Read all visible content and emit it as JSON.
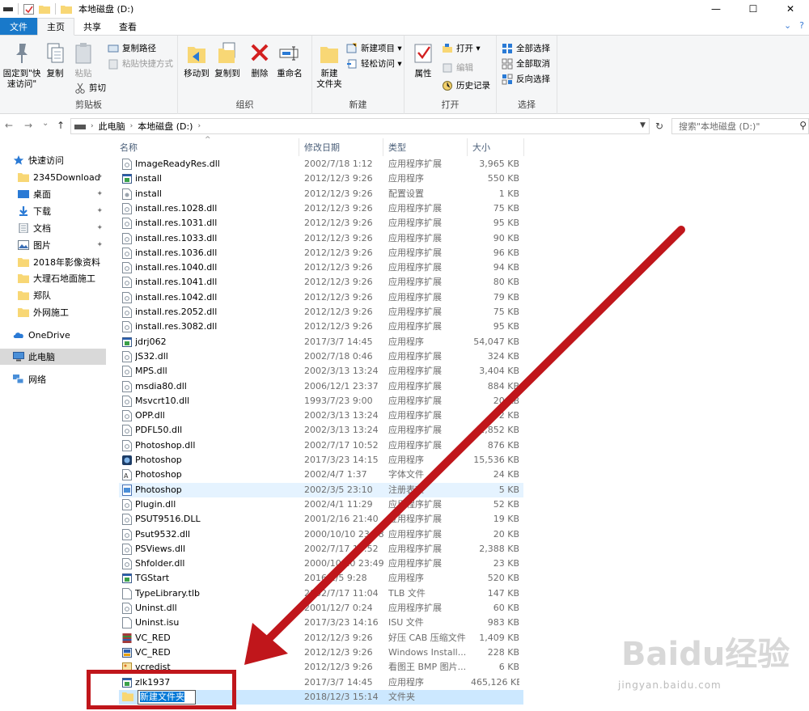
{
  "window": {
    "title": "本地磁盘 (D:)",
    "minimize": "—",
    "maximize": "☐",
    "close": "✕"
  },
  "tabs": {
    "file": "文件",
    "home": "主页",
    "share": "共享",
    "view": "查看"
  },
  "ribbon": {
    "clipboard": {
      "label": "剪贴板",
      "pin": "固定到\"快速访问\"",
      "copy": "复制",
      "paste": "粘贴",
      "copy_path": "复制路径",
      "paste_shortcut": "粘贴快捷方式",
      "cut": "剪切"
    },
    "organize": {
      "label": "组织",
      "move_to": "移动到",
      "copy_to": "复制到",
      "delete": "删除",
      "rename": "重命名"
    },
    "new": {
      "label": "新建",
      "new_folder": "新建\n文件夹",
      "new_item": "新建项目 ▾",
      "easy_access": "轻松访问 ▾"
    },
    "open": {
      "label": "打开",
      "properties": "属性",
      "open": "打开 ▾",
      "edit": "编辑",
      "history": "历史记录"
    },
    "select": {
      "label": "选择",
      "select_all": "全部选择",
      "select_none": "全部取消",
      "invert": "反向选择"
    }
  },
  "address": {
    "back": "←",
    "forward": "→",
    "recent": "⌄",
    "up": "↑",
    "crumb1": "此电脑",
    "crumb2": "本地磁盘 (D:)",
    "search_placeholder": "搜索\"本地磁盘 (D:)\""
  },
  "nav": [
    {
      "label": "快速访问",
      "icon": "star-icon",
      "pinned": false
    },
    {
      "label": "2345Download",
      "icon": "folder-icon",
      "pinned": true
    },
    {
      "label": "桌面",
      "icon": "desktop-icon",
      "pinned": true
    },
    {
      "label": "下载",
      "icon": "download-icon",
      "pinned": true
    },
    {
      "label": "文档",
      "icon": "document-icon",
      "pinned": true
    },
    {
      "label": "图片",
      "icon": "picture-icon",
      "pinned": true
    },
    {
      "label": "2018年影像资料",
      "icon": "folder-icon",
      "pinned": false
    },
    {
      "label": "大理石地面施工",
      "icon": "folder-icon",
      "pinned": false
    },
    {
      "label": "郑队",
      "icon": "folder-icon",
      "pinned": false
    },
    {
      "label": "外网施工",
      "icon": "folder-icon",
      "pinned": false
    },
    {
      "label": "OneDrive",
      "icon": "cloud-icon",
      "pinned": false
    },
    {
      "label": "此电脑",
      "icon": "computer-icon",
      "pinned": false
    },
    {
      "label": "网络",
      "icon": "network-icon",
      "pinned": false
    }
  ],
  "columns": {
    "name": "名称",
    "date": "修改日期",
    "type": "类型",
    "size": "大小"
  },
  "files": [
    {
      "name": "ImageReadyRes.dll",
      "date": "2002/7/18 1:12",
      "type": "应用程序扩展",
      "size": "3,965 KB",
      "icon": "dll-icon"
    },
    {
      "name": "install",
      "date": "2012/12/3 9:26",
      "type": "应用程序",
      "size": "550 KB",
      "icon": "exe-icon"
    },
    {
      "name": "install",
      "date": "2012/12/3 9:26",
      "type": "配置设置",
      "size": "1 KB",
      "icon": "ini-icon"
    },
    {
      "name": "install.res.1028.dll",
      "date": "2012/12/3 9:26",
      "type": "应用程序扩展",
      "size": "75 KB",
      "icon": "dll-icon"
    },
    {
      "name": "install.res.1031.dll",
      "date": "2012/12/3 9:26",
      "type": "应用程序扩展",
      "size": "95 KB",
      "icon": "dll-icon"
    },
    {
      "name": "install.res.1033.dll",
      "date": "2012/12/3 9:26",
      "type": "应用程序扩展",
      "size": "90 KB",
      "icon": "dll-icon"
    },
    {
      "name": "install.res.1036.dll",
      "date": "2012/12/3 9:26",
      "type": "应用程序扩展",
      "size": "96 KB",
      "icon": "dll-icon"
    },
    {
      "name": "install.res.1040.dll",
      "date": "2012/12/3 9:26",
      "type": "应用程序扩展",
      "size": "94 KB",
      "icon": "dll-icon"
    },
    {
      "name": "install.res.1041.dll",
      "date": "2012/12/3 9:26",
      "type": "应用程序扩展",
      "size": "80 KB",
      "icon": "dll-icon"
    },
    {
      "name": "install.res.1042.dll",
      "date": "2012/12/3 9:26",
      "type": "应用程序扩展",
      "size": "79 KB",
      "icon": "dll-icon"
    },
    {
      "name": "install.res.2052.dll",
      "date": "2012/12/3 9:26",
      "type": "应用程序扩展",
      "size": "75 KB",
      "icon": "dll-icon"
    },
    {
      "name": "install.res.3082.dll",
      "date": "2012/12/3 9:26",
      "type": "应用程序扩展",
      "size": "95 KB",
      "icon": "dll-icon"
    },
    {
      "name": "jdrj062",
      "date": "2017/3/7 14:45",
      "type": "应用程序",
      "size": "54,047 KB",
      "icon": "exe-icon"
    },
    {
      "name": "JS32.dll",
      "date": "2002/7/18 0:46",
      "type": "应用程序扩展",
      "size": "324 KB",
      "icon": "dll-icon"
    },
    {
      "name": "MPS.dll",
      "date": "2002/3/13 13:24",
      "type": "应用程序扩展",
      "size": "3,404 KB",
      "icon": "dll-icon"
    },
    {
      "name": "msdia80.dll",
      "date": "2006/12/1 23:37",
      "type": "应用程序扩展",
      "size": "884 KB",
      "icon": "dll-icon"
    },
    {
      "name": "Msvcrt10.dll",
      "date": "1993/7/23 9:00",
      "type": "应用程序扩展",
      "size": "20 KB",
      "icon": "dll-icon"
    },
    {
      "name": "OPP.dll",
      "date": "2002/3/13 13:24",
      "type": "应用程序扩展",
      "size": "92 KB",
      "icon": "dll-icon"
    },
    {
      "name": "PDFL50.dll",
      "date": "2002/3/13 13:24",
      "type": "应用程序扩展",
      "size": "2,852 KB",
      "icon": "dll-icon"
    },
    {
      "name": "Photoshop.dll",
      "date": "2002/7/17 10:52",
      "type": "应用程序扩展",
      "size": "876 KB",
      "icon": "dll-icon"
    },
    {
      "name": "Photoshop",
      "date": "2017/3/23 14:15",
      "type": "应用程序",
      "size": "15,536 KB",
      "icon": "photoshop-icon"
    },
    {
      "name": "Photoshop",
      "date": "2002/4/7 1:37",
      "type": "字体文件",
      "size": "24 KB",
      "icon": "font-icon"
    },
    {
      "name": "Photoshop",
      "date": "2002/3/5 23:10",
      "type": "注册表项",
      "size": "5 KB",
      "icon": "registry-icon"
    },
    {
      "name": "Plugin.dll",
      "date": "2002/4/1 11:29",
      "type": "应用程序扩展",
      "size": "52 KB",
      "icon": "dll-icon"
    },
    {
      "name": "PSUT9516.DLL",
      "date": "2001/2/16 21:40",
      "type": "应用程序扩展",
      "size": "19 KB",
      "icon": "dll-icon"
    },
    {
      "name": "Psut9532.dll",
      "date": "2000/10/10 23:48",
      "type": "应用程序扩展",
      "size": "20 KB",
      "icon": "dll-icon"
    },
    {
      "name": "PSViews.dll",
      "date": "2002/7/17 10:52",
      "type": "应用程序扩展",
      "size": "2,388 KB",
      "icon": "dll-icon"
    },
    {
      "name": "Shfolder.dll",
      "date": "2000/10/10 23:49",
      "type": "应用程序扩展",
      "size": "23 KB",
      "icon": "dll-icon"
    },
    {
      "name": "TGStart",
      "date": "2016/1/5 9:28",
      "type": "应用程序",
      "size": "520 KB",
      "icon": "exe-icon"
    },
    {
      "name": "TypeLibrary.tlb",
      "date": "2002/7/17 11:04",
      "type": "TLB 文件",
      "size": "147 KB",
      "icon": "file-icon"
    },
    {
      "name": "Uninst.dll",
      "date": "2001/12/7 0:24",
      "type": "应用程序扩展",
      "size": "60 KB",
      "icon": "dll-icon"
    },
    {
      "name": "Uninst.isu",
      "date": "2017/3/23 14:16",
      "type": "ISU 文件",
      "size": "983 KB",
      "icon": "file-icon"
    },
    {
      "name": "VC_RED",
      "date": "2012/12/3 9:26",
      "type": "好压 CAB 压缩文件",
      "size": "1,409 KB",
      "icon": "archive-icon"
    },
    {
      "name": "VC_RED",
      "date": "2012/12/3 9:26",
      "type": "Windows Install...",
      "size": "228 KB",
      "icon": "installer-icon"
    },
    {
      "name": "vcredist",
      "date": "2012/12/3 9:26",
      "type": "看图王 BMP 图片...",
      "size": "6 KB",
      "icon": "image-icon"
    },
    {
      "name": "zlk1937",
      "date": "2017/3/7 14:45",
      "type": "应用程序",
      "size": "465,126 KB",
      "icon": "exe-icon"
    }
  ],
  "new_folder_row": {
    "name": "新建文件夹",
    "date": "2018/12/3 15:14",
    "type": "文件夹",
    "size": ""
  },
  "watermark": {
    "main": "Baidu经验",
    "url": "jingyan.baidu.com"
  },
  "colors": {
    "accent": "#1979ca",
    "annotation": "#c0161b",
    "selection": "#cce8ff",
    "hover": "#e5f3ff"
  }
}
